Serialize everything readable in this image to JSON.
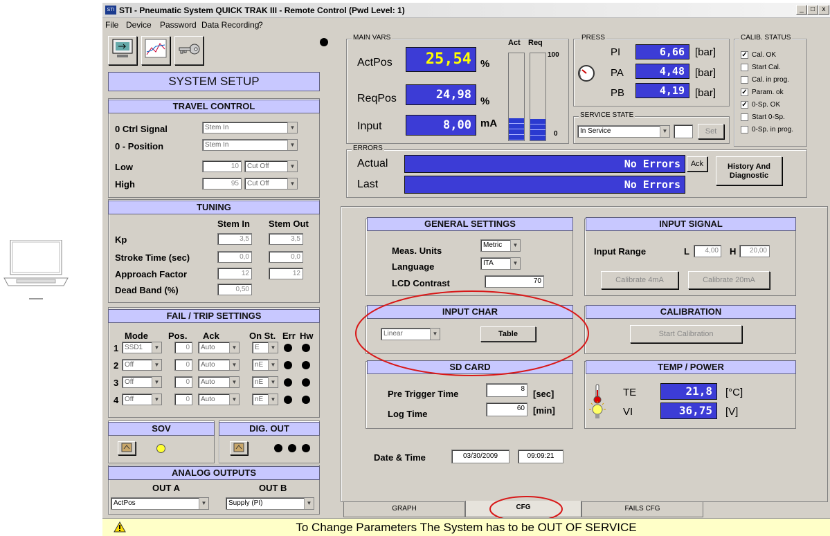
{
  "window": {
    "title": "STI - Pneumatic System QUICK TRAK III - Remote Control (Pwd Level: 1)",
    "btn_min": "_",
    "btn_max": "□",
    "btn_close": "x"
  },
  "menu": [
    "File",
    "Device",
    "Password",
    "Data Recording",
    "?"
  ],
  "system_setup": {
    "title": "SYSTEM SETUP"
  },
  "travel": {
    "title": "TRAVEL CONTROL",
    "ctrl_signal_label": "0 Ctrl Signal",
    "ctrl_signal_value": "Stem In",
    "position_label": "0 - Position",
    "position_value": "Stem In",
    "low_label": "Low",
    "low_value": "10",
    "low_mode": "Cut Off",
    "high_label": "High",
    "high_value": "95",
    "high_mode": "Cut Off"
  },
  "tuning": {
    "title": "TUNING",
    "col1": "Stem In",
    "col2": "Stem Out",
    "rows": [
      {
        "label": "Kp",
        "v1": "3,5",
        "v2": "3,5"
      },
      {
        "label": "Stroke Time (sec)",
        "v1": "0,0",
        "v2": "0,0"
      },
      {
        "label": "Approach Factor",
        "v1": "12",
        "v2": "12"
      },
      {
        "label": "Dead Band  (%)",
        "v1": "0,50",
        "v2": ""
      }
    ]
  },
  "fail": {
    "title": "FAIL / TRIP SETTINGS",
    "headers": [
      "Mode",
      "Pos.",
      "Ack",
      "On St.",
      "Err",
      "Hw"
    ],
    "rows": [
      {
        "n": "1",
        "mode": "SSD1",
        "pos": "0",
        "ack": "Auto",
        "on": "E"
      },
      {
        "n": "2",
        "mode": "Off",
        "pos": "0",
        "ack": "Auto",
        "on": "nE"
      },
      {
        "n": "3",
        "mode": "Off",
        "pos": "0",
        "ack": "Auto",
        "on": "nE"
      },
      {
        "n": "4",
        "mode": "Off",
        "pos": "0",
        "ack": "Auto",
        "on": "nE"
      }
    ]
  },
  "sov": {
    "title": "SOV"
  },
  "dig_out": {
    "title": "DIG. OUT"
  },
  "analog": {
    "title": "ANALOG OUTPUTS",
    "out_a": "OUT A",
    "out_b": "OUT B",
    "a_value": "ActPos",
    "b_value": "Supply (PI)"
  },
  "main_vars": {
    "title": "MAIN VARS",
    "act_label": "ActPos",
    "act_value": "25,54",
    "act_unit": "%",
    "req_label": "ReqPos",
    "req_value": "24,98",
    "req_unit": "%",
    "input_label": "Input",
    "input_value": "8,00",
    "input_unit": "mA",
    "bar_act": "Act",
    "bar_req": "Req",
    "scale_max": "100",
    "scale_min": "0",
    "act_level": 0.2554,
    "req_level": 0.2498
  },
  "press": {
    "title": "PRESS",
    "rows": [
      {
        "label": "PI",
        "value": "6,66",
        "unit": "[bar]"
      },
      {
        "label": "PA",
        "value": "4,48",
        "unit": "[bar]"
      },
      {
        "label": "PB",
        "value": "4,19",
        "unit": "[bar]"
      }
    ]
  },
  "service": {
    "title": "SERVICE STATE",
    "value": "In Service",
    "set": "Set"
  },
  "calib": {
    "title": "CALIB. STATUS",
    "items": [
      {
        "label": "Cal. OK",
        "checked": true
      },
      {
        "label": "Start Cal.",
        "checked": false
      },
      {
        "label": "Cal. in prog.",
        "checked": false
      },
      {
        "label": "Param. ok",
        "checked": true
      },
      {
        "label": "0-Sp. OK",
        "checked": true
      },
      {
        "label": "Start 0-Sp.",
        "checked": false
      },
      {
        "label": "0-Sp. in prog.",
        "checked": false
      }
    ]
  },
  "errors": {
    "title": "ERRORS",
    "actual_label": "Actual",
    "actual_value": "No Errors",
    "last_label": "Last",
    "last_value": "No Errors",
    "ack": "Ack",
    "history": "History And Diagnostic"
  },
  "general": {
    "title": "GENERAL SETTINGS",
    "units_label": "Meas. Units",
    "units_value": "Metric",
    "lang_label": "Language",
    "lang_value": "ITA",
    "lcd_label": "LCD Contrast",
    "lcd_value": "70"
  },
  "input_signal": {
    "title": "INPUT SIGNAL",
    "range_label": "Input Range",
    "l": "L",
    "l_value": "4,00",
    "h": "H",
    "h_value": "20,00",
    "cal4": "Calibrate 4mA",
    "cal20": "Calibrate 20mA"
  },
  "input_char": {
    "title": "INPUT CHAR",
    "value": "Linear",
    "table": "Table"
  },
  "calibration": {
    "title": "CALIBRATION",
    "start": "Start Calibration"
  },
  "sd": {
    "title": "SD CARD",
    "pre_label": "Pre Trigger Time",
    "pre_value": "8",
    "pre_unit": "[sec]",
    "log_label": "Log Time",
    "log_value": "60",
    "log_unit": "[min]"
  },
  "temp": {
    "title": "TEMP  /  POWER",
    "te_label": "TE",
    "te_value": "21,8",
    "te_unit": "[°C]",
    "vi_label": "VI",
    "vi_value": "36,75",
    "vi_unit": "[V]"
  },
  "datetime": {
    "label": "Date & Time",
    "date": "03/30/2009",
    "time": "09:09:21"
  },
  "tabs": [
    "GRAPH",
    "CFG",
    "FAILS CFG"
  ],
  "status": {
    "message": "To Change Parameters The System has to be OUT OF SERVICE"
  },
  "colors": {
    "panel": "#d4d0c8",
    "header": "#c8c8ff",
    "digital": "#3c3cd6",
    "annotation": "#d81818",
    "status": "#ffffc8"
  }
}
